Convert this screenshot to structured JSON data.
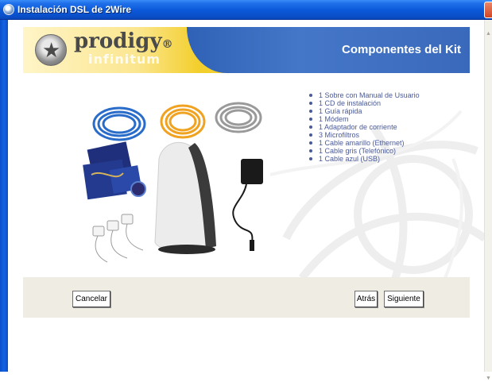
{
  "window": {
    "title": "Instalación DSL de 2Wire"
  },
  "header": {
    "logo_name": "prodigy",
    "logo_suffix": "infinitum",
    "page_title": "Componentes del Kit"
  },
  "components": [
    "1 Sobre con Manual de Usuario",
    "1 CD de instalación",
    "1 Guía rápida",
    "1 Módem",
    "1 Adaptador de corriente",
    "3 Microfiltros",
    "1 Cable amarillo (Ethernet)",
    "1 Cable gris (Telefónico)",
    "1 Cable azul (USB)"
  ],
  "buttons": {
    "cancel": "Cancelar",
    "back": "Atrás",
    "next": "Siguiente"
  },
  "colors": {
    "titlebar": "#0a58d8",
    "header_yellow": "#f3cf2d",
    "header_blue": "#3a69bb",
    "list_text": "#4a5a9a",
    "button_bar": "#efede3"
  }
}
